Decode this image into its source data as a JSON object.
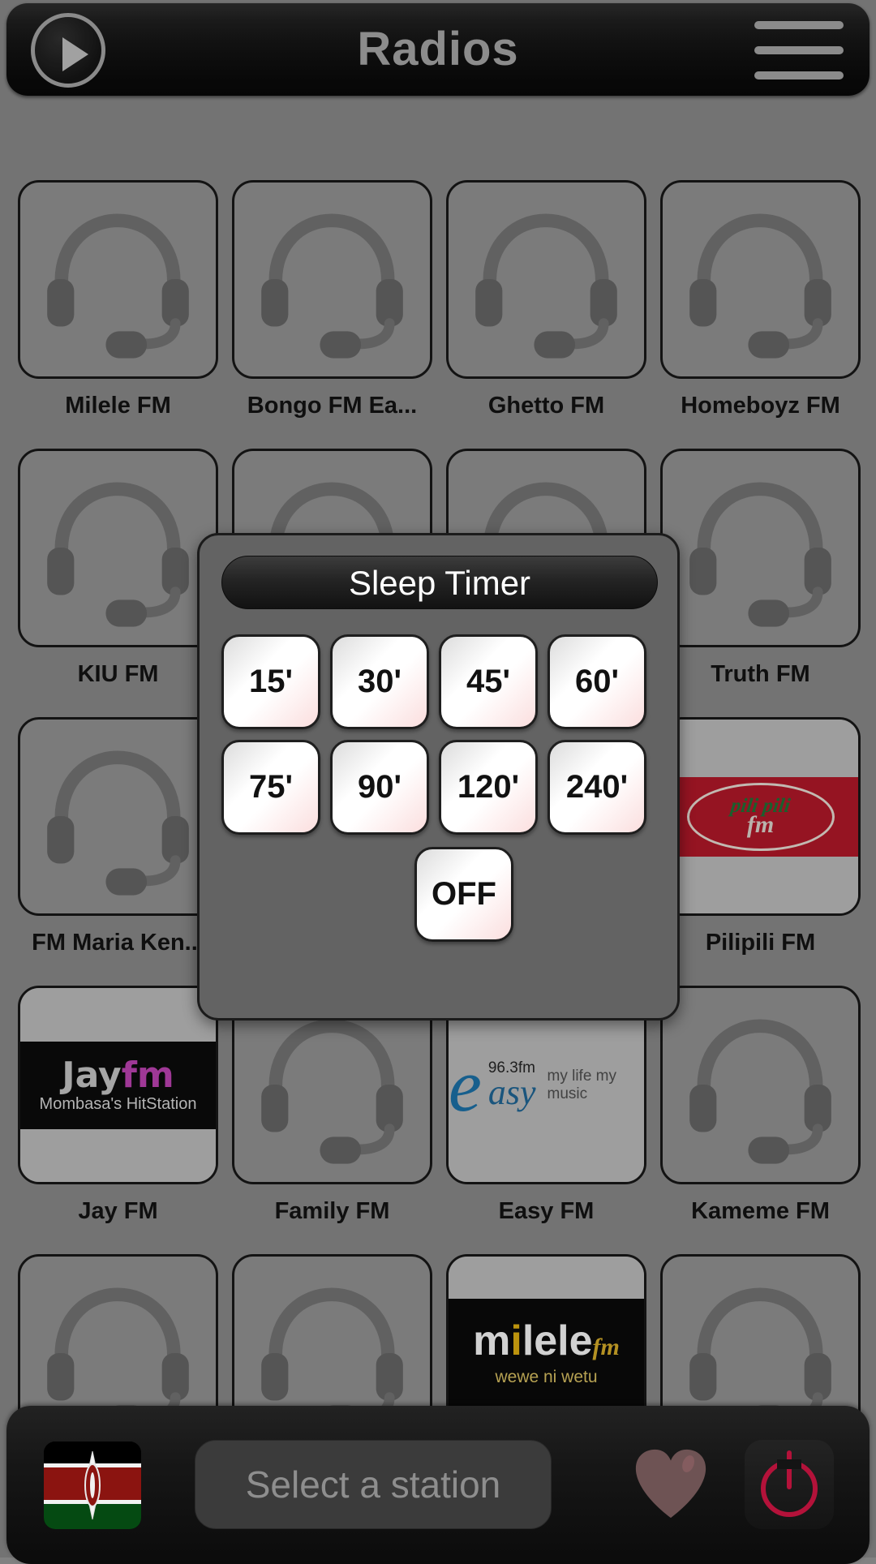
{
  "header": {
    "title": "Radios",
    "play_icon": "play-icon",
    "menu_icon": "hamburger-menu-icon"
  },
  "grid": {
    "rows": [
      [
        {
          "name": "Milele FM",
          "logo": "none"
        },
        {
          "name": "Bongo FM Ea...",
          "logo": "none"
        },
        {
          "name": "Ghetto FM",
          "logo": "none"
        },
        {
          "name": "Homeboyz FM",
          "logo": "none"
        }
      ],
      [
        {
          "name": "KIU FM",
          "logo": "none"
        },
        {
          "name": "",
          "logo": "none"
        },
        {
          "name": "",
          "logo": "none"
        },
        {
          "name": "Truth FM",
          "logo": "none"
        }
      ],
      [
        {
          "name": "FM Maria Ken...",
          "logo": "none"
        },
        {
          "name": "",
          "logo": "none"
        },
        {
          "name": "",
          "logo": "none"
        },
        {
          "name": "Pilipili FM",
          "logo": "pilipili"
        }
      ],
      [
        {
          "name": "Jay FM",
          "logo": "jay"
        },
        {
          "name": "Family FM",
          "logo": "none"
        },
        {
          "name": "Easy FM",
          "logo": "easy"
        },
        {
          "name": "Kameme FM",
          "logo": "none"
        }
      ],
      [
        {
          "name": "",
          "logo": "none"
        },
        {
          "name": "",
          "logo": "none"
        },
        {
          "name": "",
          "logo": "milele"
        },
        {
          "name": "",
          "logo": "none"
        }
      ]
    ]
  },
  "logos": {
    "pilipili": {
      "line1": "pili pili",
      "line2": "fm",
      "bg": "#a61726",
      "green": "#1e6b33"
    },
    "jay": {
      "word1": "Jay",
      "word2": "fm",
      "tagline": "Mombasa's HitStation",
      "accent": "#b23fa8"
    },
    "easy": {
      "initial": "e",
      "freq": "96.3fm",
      "word": "asy",
      "tagline": "my life my music",
      "accent": "#1a6a9e"
    },
    "milele": {
      "word_a": "m",
      "word_b": "i",
      "word_c": "lele",
      "fm": "fm",
      "tagline": "wewe ni wetu",
      "accent": "#d2a410"
    }
  },
  "dialog": {
    "title": "Sleep Timer",
    "row1": [
      "15'",
      "30'",
      "45'",
      "60'"
    ],
    "row2": [
      "75'",
      "90'",
      "120'",
      "240'"
    ],
    "off_label": "OFF"
  },
  "bottom_bar": {
    "flag_icon": "kenya-flag-icon",
    "station_placeholder": "Select a station",
    "favorite_icon": "heart-icon",
    "power_icon": "power-icon",
    "power_color": "#b4123a"
  }
}
